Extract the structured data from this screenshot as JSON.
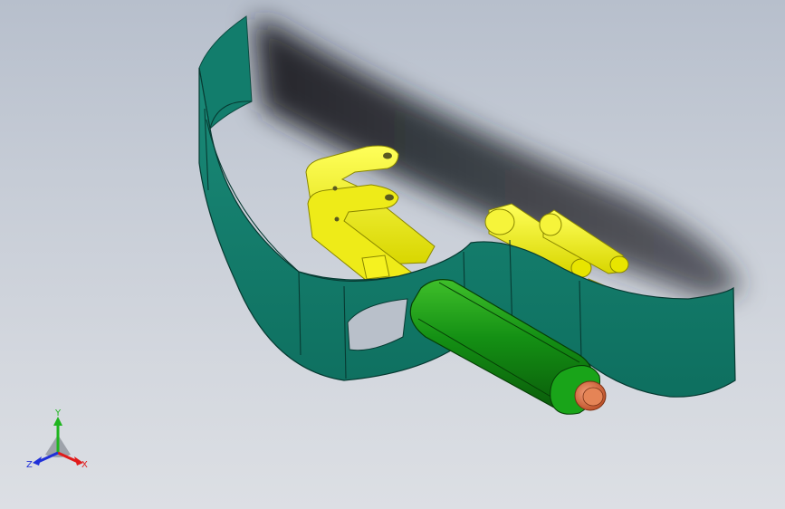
{
  "viewport": {
    "background_top": "#b7bfcc",
    "background_bottom": "#dcdfe4"
  },
  "model": {
    "bracket_color": "#13806e",
    "cylinder_color": "#1a8f1a",
    "plates_color": "#f2ef10",
    "end_cap_color": "#d9744a"
  },
  "triad": {
    "x_label": "X",
    "y_label": "Y",
    "z_label": "Z",
    "x_color": "#e01b1b",
    "y_color": "#1fb51f",
    "z_color": "#2030d8"
  }
}
